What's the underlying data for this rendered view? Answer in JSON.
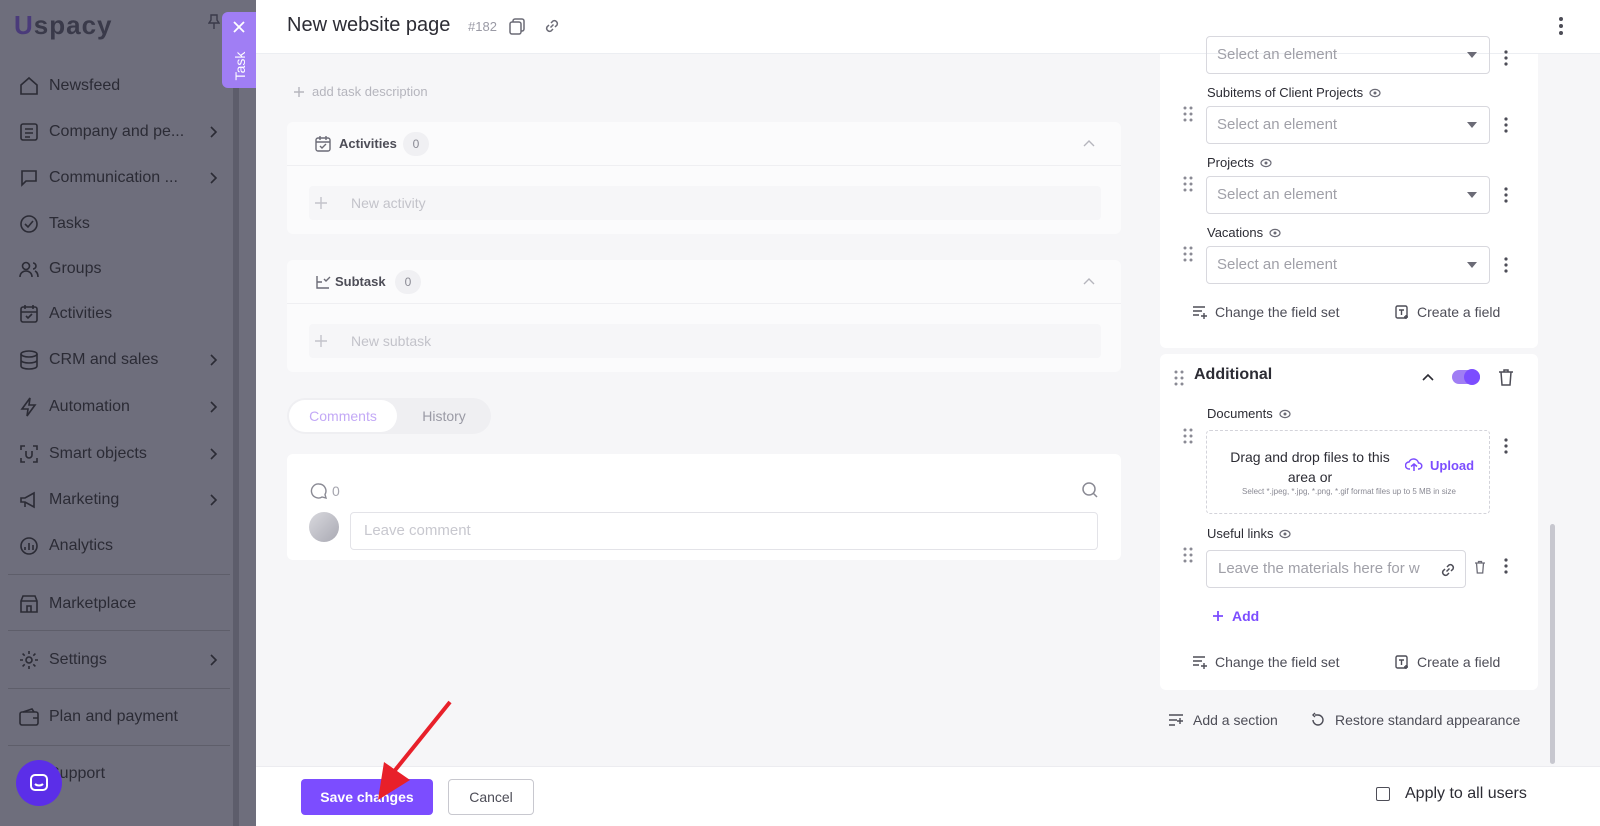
{
  "app": {
    "logo": "spacy",
    "logo_u": "U"
  },
  "sidebar": {
    "items": [
      {
        "label": "Newsfeed",
        "icon": "home-icon",
        "chevron": false
      },
      {
        "label": "Company and pe...",
        "icon": "company-icon",
        "chevron": true
      },
      {
        "label": "Communication ...",
        "icon": "communication-icon",
        "chevron": true
      },
      {
        "label": "Tasks",
        "icon": "tasks-icon",
        "chevron": false
      },
      {
        "label": "Groups",
        "icon": "groups-icon",
        "chevron": false
      },
      {
        "label": "Activities",
        "icon": "activities-icon",
        "chevron": false
      },
      {
        "label": "CRM and sales",
        "icon": "crm-icon",
        "chevron": true
      },
      {
        "label": "Automation",
        "icon": "automation-icon",
        "chevron": true
      },
      {
        "label": "Smart objects",
        "icon": "smart-objects-icon",
        "chevron": true
      },
      {
        "label": "Marketing",
        "icon": "marketing-icon",
        "chevron": true
      },
      {
        "label": "Analytics",
        "icon": "analytics-icon",
        "chevron": false
      },
      {
        "label": "Marketplace",
        "icon": "marketplace-icon",
        "chevron": false
      },
      {
        "label": "Settings",
        "icon": "settings-icon",
        "chevron": true
      },
      {
        "label": "Plan and payment",
        "icon": "wallet-icon",
        "chevron": false
      },
      {
        "label": "Support",
        "icon": "support-icon",
        "chevron": false
      }
    ]
  },
  "task_tab": {
    "label": "Task"
  },
  "header": {
    "title": "New website page",
    "task_id": "#182"
  },
  "description": {
    "add_label": "add task description"
  },
  "activities": {
    "label": "Activities",
    "count": "0",
    "placeholder": "New activity"
  },
  "subtask": {
    "label": "Subtask",
    "count": "0",
    "placeholder": "New subtask"
  },
  "tabs": [
    {
      "label": "Comments",
      "active": true
    },
    {
      "label": "History",
      "active": false
    }
  ],
  "comments": {
    "count": "0",
    "placeholder": "Leave comment"
  },
  "fields_top": [
    {
      "label": "",
      "placeholder": "Select an element"
    },
    {
      "label": "Subitems of Client Projects",
      "placeholder": "Select an element"
    },
    {
      "label": "Projects",
      "placeholder": "Select an element"
    },
    {
      "label": "Vacations",
      "placeholder": "Select an element"
    }
  ],
  "section_actions": {
    "change_set": "Change the field set",
    "create_field": "Create a field"
  },
  "additional": {
    "title": "Additional",
    "enabled": true,
    "documents_label": "Documents",
    "drop_text": "Drag and drop files to this area or",
    "upload_label": "Upload",
    "drop_hint": "Select *.jpeg, *.jpg, *.png, *.gif format files up to 5 MB in size",
    "useful_links_label": "Useful links",
    "links_placeholder": "Leave the materials here for w",
    "add_label": "Add"
  },
  "panel_actions": {
    "add_section": "Add a section",
    "restore": "Restore standard appearance"
  },
  "bottom": {
    "save": "Save changes",
    "cancel": "Cancel",
    "apply_all": "Apply to all users",
    "apply_checked": false
  },
  "colors": {
    "accent": "#7c4dff",
    "sidebar_bg": "#6e6e7c",
    "tab_bg": "#a07ef4"
  }
}
